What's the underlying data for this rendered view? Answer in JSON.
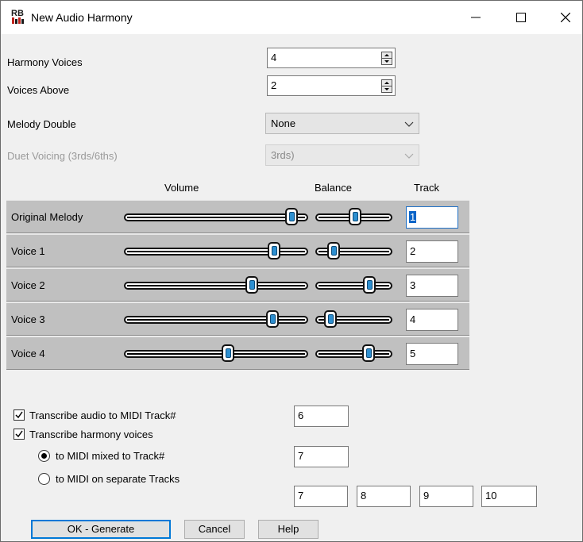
{
  "window": {
    "title": "New Audio Harmony",
    "icon": "band-in-a-box-rb-icon"
  },
  "fields": {
    "harmony_voices_label": "Harmony Voices",
    "harmony_voices_value": "4",
    "voices_above_label": "Voices Above",
    "voices_above_value": "2",
    "melody_double_label": "Melody Double",
    "melody_double_value": "None",
    "duet_voicing_label": "Duet Voicing (3rds/6ths)",
    "duet_voicing_value": "3rds)"
  },
  "mixer": {
    "headers": {
      "volume": "Volume",
      "balance": "Balance",
      "track": "Track"
    },
    "rows": [
      {
        "label": "Original Melody",
        "volume": 0.94,
        "balance": 0.52,
        "track": "1",
        "focused": true
      },
      {
        "label": "Voice 1",
        "volume": 0.84,
        "balance": 0.18,
        "track": "2",
        "focused": false
      },
      {
        "label": "Voice 2",
        "volume": 0.71,
        "balance": 0.74,
        "track": "3",
        "focused": false
      },
      {
        "label": "Voice 3",
        "volume": 0.83,
        "balance": 0.14,
        "track": "4",
        "focused": false
      },
      {
        "label": "Voice 4",
        "volume": 0.57,
        "balance": 0.73,
        "track": "5",
        "focused": false
      }
    ]
  },
  "transcribe": {
    "audio_to_midi_label": "Transcribe audio to MIDI Track#",
    "audio_to_midi_checked": true,
    "audio_to_midi_track": "6",
    "harmony_voices_label": "Transcribe harmony voices",
    "harmony_voices_checked": true,
    "mixed_label": "to MIDI mixed to Track#",
    "mixed_selected": true,
    "mixed_track": "7",
    "separate_label": "to MIDI on separate Tracks",
    "separate_selected": false,
    "separate_tracks": [
      "7",
      "8",
      "9",
      "10"
    ]
  },
  "buttons": {
    "ok": "OK - Generate",
    "cancel": "Cancel",
    "help": "Help"
  },
  "colors": {
    "dialog_bg": "#f0f0f0",
    "mixer_row_bg": "#c0c0c0",
    "thumb_blue": "#2d8fd0",
    "focus_blue": "#0078d7"
  }
}
